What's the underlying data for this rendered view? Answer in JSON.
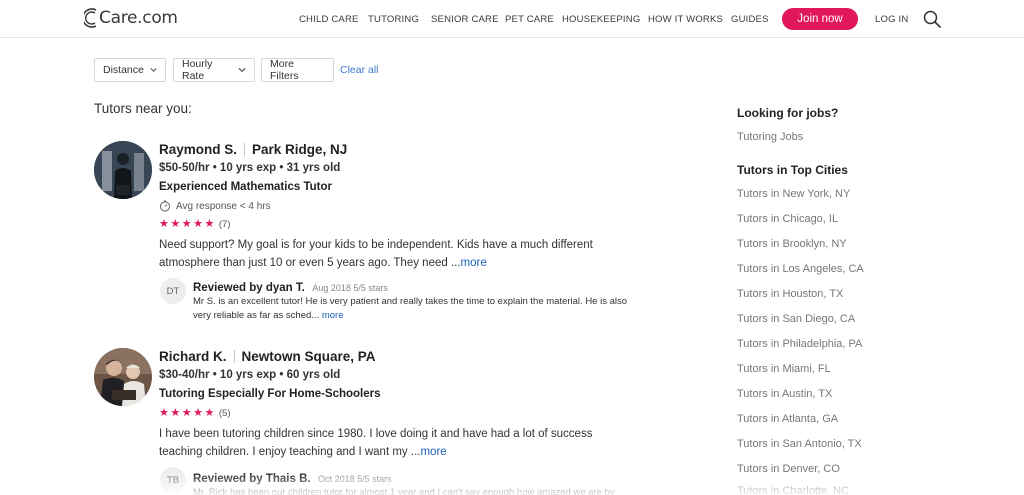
{
  "header": {
    "logo_text": "Care.com",
    "nav": [
      "CHILD CARE",
      "TUTORING",
      "SENIOR CARE",
      "PET CARE",
      "HOUSEKEEPING",
      "HOW IT WORKS",
      "GUIDES"
    ],
    "join_label": "Join now",
    "login_label": "LOG IN"
  },
  "filters": {
    "distance": "Distance",
    "hourly_rate": "Hourly Rate",
    "more_filters": "More Filters",
    "clear_all": "Clear all"
  },
  "section_title": "Tutors near you:",
  "listings": [
    {
      "name": "Raymond S.",
      "location": "Park Ridge, NJ",
      "rate_line": "$50-50/hr • 10 yrs exp • 31 yrs old",
      "headline": "Experienced Mathematics Tutor",
      "response": "Avg response < 4 hrs",
      "rating": 5,
      "review_count": "(7)",
      "description": "Need support? My goal is for your kids to be independent. Kids have a much different atmosphere than just 10 or even 5 years ago. They need ...",
      "more_label": "more",
      "review": {
        "initials": "DT",
        "by": "Reviewed by dyan T.",
        "meta": "Aug 2018 5/5 stars",
        "text": "Mr S. is an excellent tutor! He is very patient and really takes the time to explain the material. He is also very reliable as far as sched...",
        "more_label": "more"
      }
    },
    {
      "name": "Richard K.",
      "location": "Newtown Square, PA",
      "rate_line": "$30-40/hr • 10 yrs exp • 60 yrs old",
      "headline": "Tutoring Especially For Home-Schoolers",
      "rating": 5,
      "review_count": "(5)",
      "description": "I have been tutoring children since 1980. I love doing it and have had a lot of success teaching children. I enjoy teaching and I want my ...",
      "more_label": "more",
      "review": {
        "initials": "TB",
        "by": "Reviewed by Thais B.",
        "meta": "Oct 2018 5/5 stars",
        "text": "Mr. Rick has been our children tutor for almost 1 year and I can't say enough how amazed we are by"
      }
    }
  ],
  "sidebar": {
    "jobs_heading": "Looking for jobs?",
    "jobs_link": "Tutoring Jobs",
    "cities_heading": "Tutors in Top Cities",
    "cities": [
      "Tutors in New York, NY",
      "Tutors in Chicago, IL",
      "Tutors in Brooklyn, NY",
      "Tutors in Los Angeles, CA",
      "Tutors in Houston, TX",
      "Tutors in San Diego, CA",
      "Tutors in Philadelphia, PA",
      "Tutors in Miami, FL",
      "Tutors in Austin, TX",
      "Tutors in Atlanta, GA",
      "Tutors in San Antonio, TX",
      "Tutors in Denver, CO",
      "Tutors in Charlotte, NC"
    ]
  },
  "colors": {
    "brand_pink": "#e0175a",
    "link_blue": "#1a5fb4"
  }
}
